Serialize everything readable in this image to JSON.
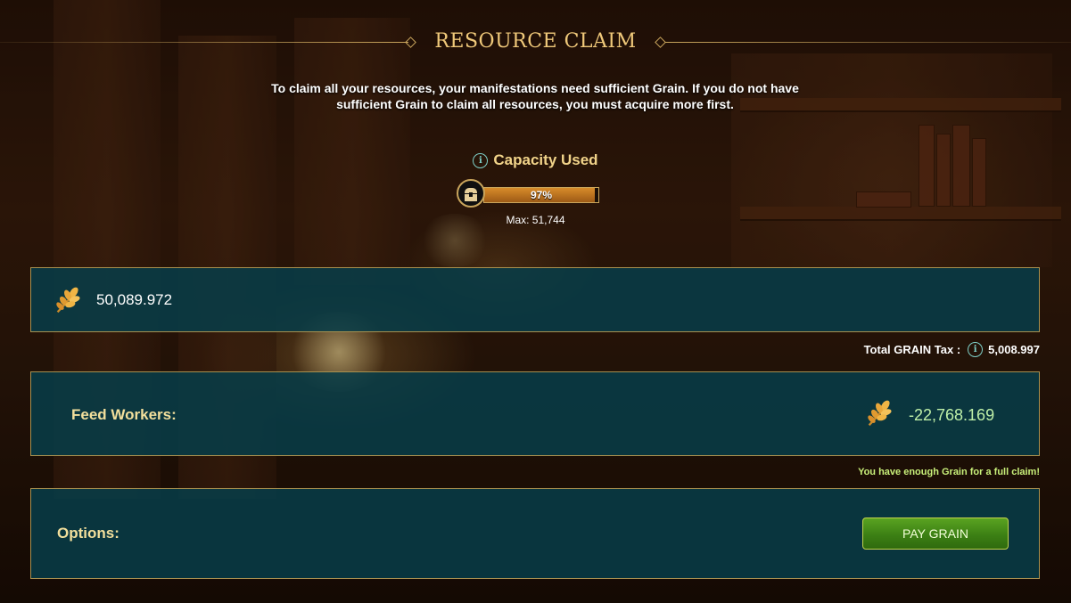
{
  "header": {
    "title": "RESOURCE CLAIM"
  },
  "intro_text": "To claim all your resources, your manifestations need sufficient Grain. If you do not have sufficient Grain to claim all resources, you must acquire more first.",
  "capacity": {
    "title": "Capacity Used",
    "percent_label": "97%",
    "percent_value": 0.97,
    "max_label": "Max: 51,744"
  },
  "grain_balance": {
    "amount": "50,089.972",
    "icon": "wheat-icon"
  },
  "tax": {
    "label": "Total GRAIN Tax :",
    "value": "5,008.997"
  },
  "feed_workers": {
    "label": "Feed Workers:",
    "amount": "-22,768.169",
    "icon": "wheat-icon"
  },
  "status_message": "You have enough Grain for a full claim!",
  "options": {
    "label": "Options:",
    "pay_button": "PAY GRAIN"
  },
  "colors": {
    "gold": "#c9a55c",
    "panel": "#073c48",
    "button_green": "#3c8014",
    "positive": "#bff0a8"
  }
}
